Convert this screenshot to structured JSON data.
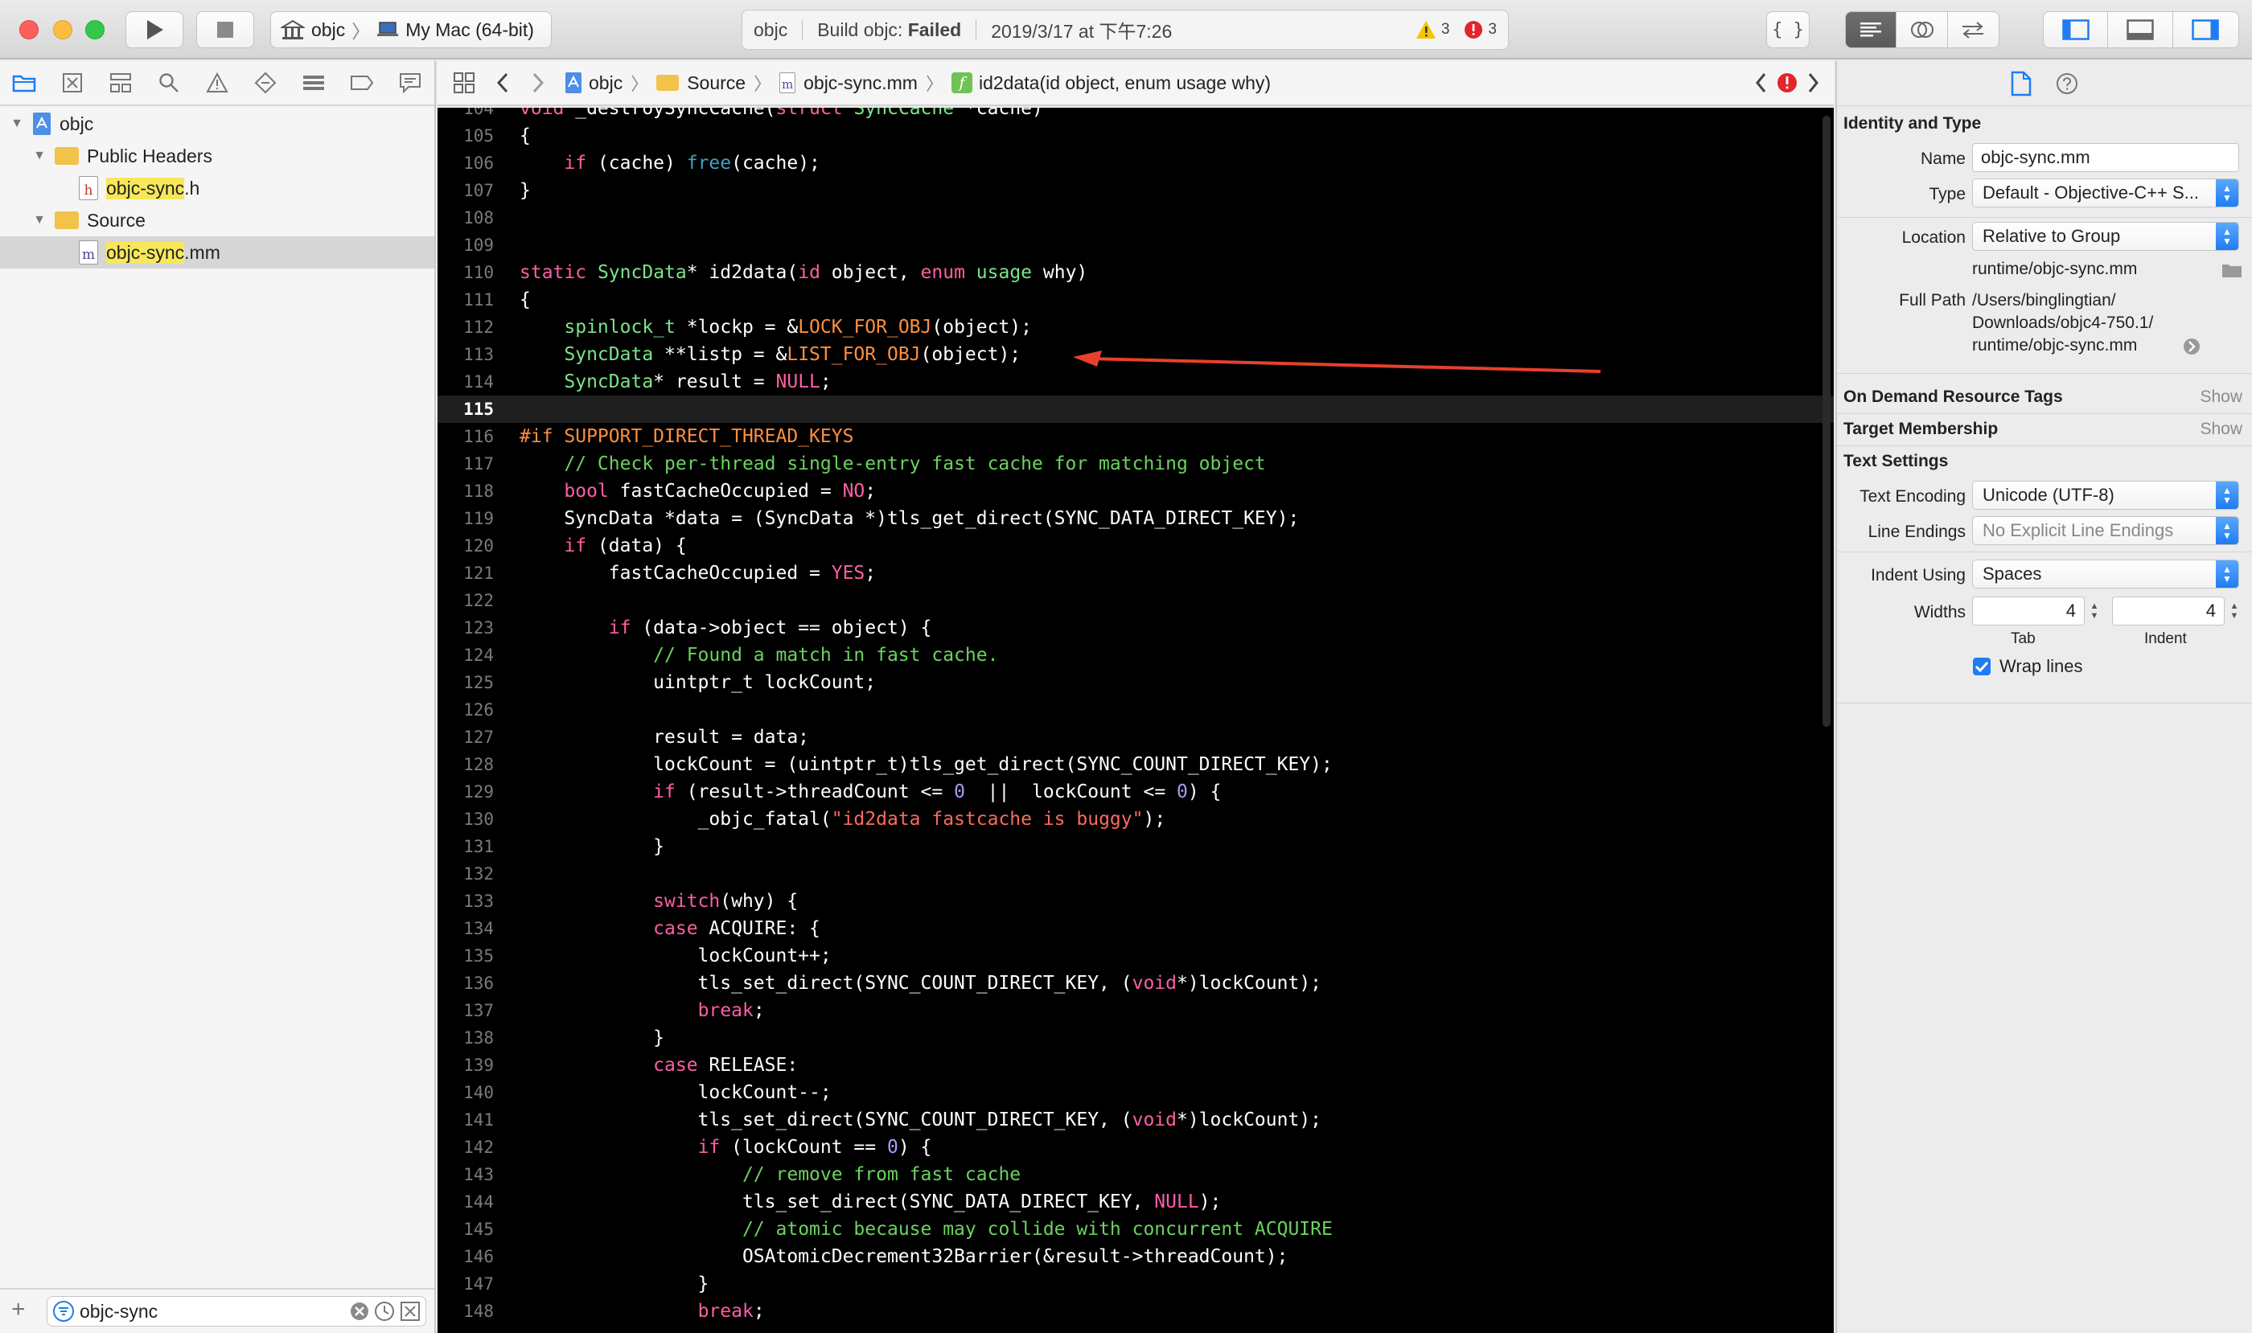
{
  "toolbar": {
    "scheme_target": "objc",
    "scheme_device": "My Mac (64-bit)",
    "activity_project": "objc",
    "activity_status_prefix": "Build objc: ",
    "activity_status_result": "Failed",
    "activity_timestamp": "2019/3/17 at 下午7:26",
    "warning_count": "3",
    "error_count": "3",
    "editor_standard_icon": "align-left-icon",
    "assistant_icon": "venn-circles-icon",
    "version_icon": "arrows-swap-icon",
    "code_review_glyph": "{ }"
  },
  "navigator": {
    "tree": [
      {
        "label": "objc",
        "kind": "project",
        "depth": 0
      },
      {
        "label": "Public Headers",
        "kind": "folder",
        "depth": 1
      },
      {
        "label_hl": "objc-sync",
        "label_rest": ".h",
        "kind": "file",
        "file_letter": "h",
        "depth": 2
      },
      {
        "label": "Source",
        "kind": "folder",
        "depth": 1
      },
      {
        "label_hl": "objc-sync",
        "label_rest": ".mm",
        "kind": "file",
        "file_letter": "m",
        "depth": 2,
        "selected": true
      }
    ],
    "filter_value": "objc-sync",
    "add_glyph": "+"
  },
  "jumpbar": {
    "crumbs": [
      "objc",
      "Source",
      "objc-sync.mm",
      "id2data(id object, enum usage why)"
    ],
    "func_badge": "f"
  },
  "editor": {
    "current_line": "115",
    "lines": [
      {
        "n": "104",
        "html": "<span class=\"kw\">void</span> _destroySyncCache(<span class=\"kw\">struct</span> <span class=\"ty\">SyncCache</span> *cache)"
      },
      {
        "n": "105",
        "html": "{"
      },
      {
        "n": "106",
        "html": "    <span class=\"kw\">if</span> (cache) <span class=\"ty\" style=\"color:#41a1c0\">free</span>(cache);"
      },
      {
        "n": "107",
        "html": "}"
      },
      {
        "n": "108",
        "html": ""
      },
      {
        "n": "109",
        "html": ""
      },
      {
        "n": "110",
        "html": "<span class=\"kw\">static</span> <span class=\"ty\">SyncData</span>* id2data(<span class=\"kw\">id</span> object, <span class=\"kw\">enum</span> <span class=\"ty\">usage</span> why)"
      },
      {
        "n": "111",
        "html": "{"
      },
      {
        "n": "112",
        "html": "    <span class=\"ty\">spinlock_t</span> *lockp = &amp;<span class=\"mac\">LOCK_FOR_OBJ</span>(object);"
      },
      {
        "n": "113",
        "html": "    <span class=\"ty\">SyncData</span> **listp = &amp;<span class=\"mac\">LIST_FOR_OBJ</span>(object);"
      },
      {
        "n": "114",
        "html": "    <span class=\"ty\">SyncData</span>* result = <span class=\"kw\">NULL</span>;"
      },
      {
        "n": "115",
        "html": ""
      },
      {
        "n": "116",
        "html": "<span class=\"pp\">#if SUPPORT_DIRECT_THREAD_KEYS</span>"
      },
      {
        "n": "117",
        "html": "    <span class=\"cm\">// Check per-thread single-entry fast cache for matching object</span>"
      },
      {
        "n": "118",
        "html": "    <span class=\"kw\">bool</span> fastCacheOccupied = <span class=\"kw\">NO</span>;"
      },
      {
        "n": "119",
        "html": "    SyncData *data = (SyncData *)tls_get_direct(SYNC_DATA_DIRECT_KEY);"
      },
      {
        "n": "120",
        "html": "    <span class=\"kw\">if</span> (data) {"
      },
      {
        "n": "121",
        "html": "        fastCacheOccupied = <span class=\"kw\">YES</span>;"
      },
      {
        "n": "122",
        "html": ""
      },
      {
        "n": "123",
        "html": "        <span class=\"kw\">if</span> (data-&gt;object == object) {"
      },
      {
        "n": "124",
        "html": "            <span class=\"cm\">// Found a match in fast cache.</span>"
      },
      {
        "n": "125",
        "html": "            uintptr_t lockCount;"
      },
      {
        "n": "126",
        "html": ""
      },
      {
        "n": "127",
        "html": "            result = data;"
      },
      {
        "n": "128",
        "html": "            lockCount = (uintptr_t)tls_get_direct(SYNC_COUNT_DIRECT_KEY);"
      },
      {
        "n": "129",
        "html": "            <span class=\"kw\">if</span> (result-&gt;threadCount &lt;= <span class=\"num\">0</span>  ||  lockCount &lt;= <span class=\"num\">0</span>) {"
      },
      {
        "n": "130",
        "html": "                _objc_fatal(<span class=\"str\">\"id2data fastcache is buggy\"</span>);"
      },
      {
        "n": "131",
        "html": "            }"
      },
      {
        "n": "132",
        "html": ""
      },
      {
        "n": "133",
        "html": "            <span class=\"kw\">switch</span>(why) {"
      },
      {
        "n": "134",
        "html": "            <span class=\"kw\">case</span> ACQUIRE: {"
      },
      {
        "n": "135",
        "html": "                lockCount++;"
      },
      {
        "n": "136",
        "html": "                tls_set_direct(SYNC_COUNT_DIRECT_KEY, (<span class=\"kw\">void</span>*)lockCount);"
      },
      {
        "n": "137",
        "html": "                <span class=\"kw\">break</span>;"
      },
      {
        "n": "138",
        "html": "            }"
      },
      {
        "n": "139",
        "html": "            <span class=\"kw\">case</span> RELEASE:"
      },
      {
        "n": "140",
        "html": "                lockCount--;"
      },
      {
        "n": "141",
        "html": "                tls_set_direct(SYNC_COUNT_DIRECT_KEY, (<span class=\"kw\">void</span>*)lockCount);"
      },
      {
        "n": "142",
        "html": "                <span class=\"kw\">if</span> (lockCount == <span class=\"num\">0</span>) {"
      },
      {
        "n": "143",
        "html": "                    <span class=\"cm\">// remove from fast cache</span>"
      },
      {
        "n": "144",
        "html": "                    tls_set_direct(SYNC_DATA_DIRECT_KEY, <span class=\"kw\">NULL</span>);"
      },
      {
        "n": "145",
        "html": "                    <span class=\"cm\">// atomic because may collide with concurrent ACQUIRE</span>"
      },
      {
        "n": "146",
        "html": "                    OSAtomicDecrement32Barrier(&amp;result-&gt;threadCount);"
      },
      {
        "n": "147",
        "html": "                }"
      },
      {
        "n": "148",
        "html": "                <span class=\"kw\">break</span>;"
      }
    ]
  },
  "inspector": {
    "identity_title": "Identity and Type",
    "name_label": "Name",
    "name_value": "objc-sync.mm",
    "type_label": "Type",
    "type_value": "Default - Objective-C++ S...",
    "location_label": "Location",
    "location_value": "Relative to Group",
    "relative_path": "runtime/objc-sync.mm",
    "fullpath_label": "Full Path",
    "fullpath_line1": "/Users/binglingtian/",
    "fullpath_line2": "Downloads/objc4-750.1/",
    "fullpath_line3": "runtime/objc-sync.mm",
    "odr_title": "On Demand Resource Tags",
    "target_title": "Target Membership",
    "show_label": "Show",
    "text_settings_title": "Text Settings",
    "encoding_label": "Text Encoding",
    "encoding_value": "Unicode (UTF-8)",
    "line_endings_label": "Line Endings",
    "line_endings_value": "No Explicit Line Endings",
    "indent_using_label": "Indent Using",
    "indent_using_value": "Spaces",
    "widths_label": "Widths",
    "tab_width": "4",
    "indent_width": "4",
    "tab_label": "Tab",
    "indent_label": "Indent",
    "wrap_label": "Wrap lines",
    "wrap_checked": true
  },
  "colors": {
    "accent": "#1f7cf2",
    "editor_bg": "#000000",
    "keyword": "#fc5fa3",
    "type": "#7ce38b",
    "comment": "#6bd35f",
    "macro": "#fd8f3f",
    "annotation_arrow": "#e8402b"
  }
}
